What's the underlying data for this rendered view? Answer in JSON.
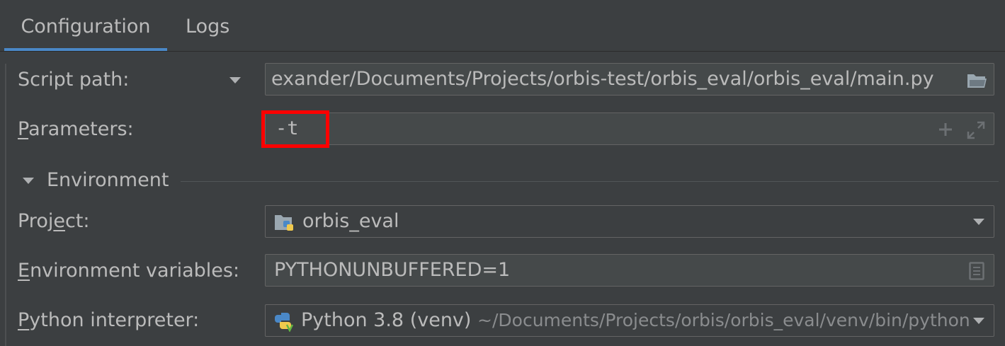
{
  "tabs": [
    {
      "label": "Configuration",
      "active": true
    },
    {
      "label": "Logs",
      "active": false
    }
  ],
  "script": {
    "label": "Script path:",
    "value": "exander/Documents/Projects/orbis-test/orbis_eval/orbis_eval/main.py"
  },
  "parameters": {
    "label_underlined": "P",
    "label_rest": "arameters:",
    "value": "-t"
  },
  "environment": {
    "section_label": "Environment",
    "project_label_a": "Proj",
    "project_label_u": "e",
    "project_label_b": "ct:",
    "project_value": "orbis_eval",
    "envvars_label_u": "E",
    "envvars_label_rest": "nvironment variables:",
    "envvars_value": "PYTHONUNBUFFERED=1",
    "interpreter_label_u": "P",
    "interpreter_label_rest": "ython interpreter:",
    "interpreter_name": "Python 3.8 (venv)",
    "interpreter_path": "~/Documents/Projects/orbis/orbis_eval/venv/bin/python"
  },
  "colors": {
    "background": "#3c3f41",
    "field": "#45494a",
    "accent": "#4a88c7",
    "highlight": "#ff0000"
  },
  "icons": [
    "chevron-down-icon",
    "folder-icon",
    "plus-icon",
    "expand-icon",
    "python-project-icon",
    "document-list-icon",
    "python-icon"
  ]
}
